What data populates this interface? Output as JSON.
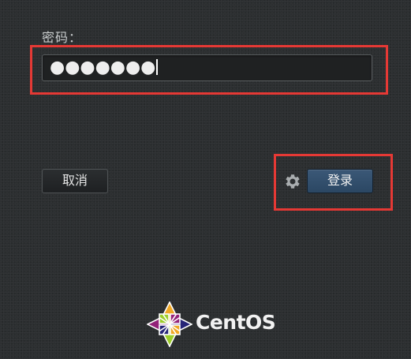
{
  "form": {
    "password_label": "密码：",
    "password_value": "●●●●●●●"
  },
  "buttons": {
    "cancel_label": "取消",
    "login_label": "登录"
  },
  "branding": {
    "name": "CentOS"
  },
  "icons": {
    "settings": "gear-icon",
    "logo": "centos-logo-icon"
  },
  "colors": {
    "background": "#2c2f31",
    "login_button": "#345170",
    "annotation": "#e53935"
  }
}
